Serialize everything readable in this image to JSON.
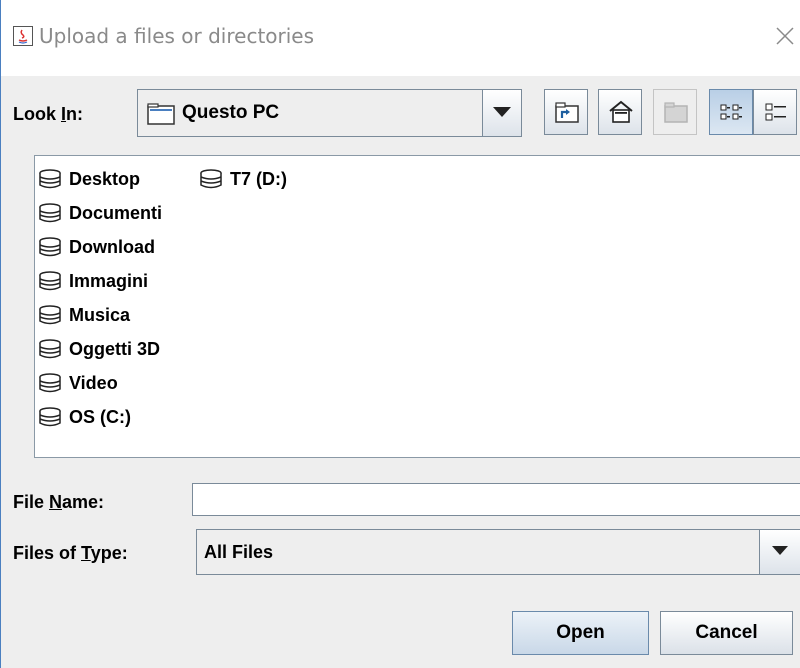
{
  "window": {
    "title": "Upload a files or directories"
  },
  "look_in": {
    "label_pre": "Look ",
    "label_mnemonic": "I",
    "label_post": "n:",
    "value": "Questo PC"
  },
  "toolbar": {
    "up_folder": "up-one-level",
    "home": "home",
    "new_folder": "create-new-folder",
    "list_view": "list",
    "details_view": "details"
  },
  "files": [
    {
      "name": "Desktop",
      "icon": "drive-icon"
    },
    {
      "name": "Documenti",
      "icon": "drive-icon"
    },
    {
      "name": "Download",
      "icon": "drive-icon"
    },
    {
      "name": "Immagini",
      "icon": "drive-icon"
    },
    {
      "name": "Musica",
      "icon": "drive-icon"
    },
    {
      "name": "Oggetti 3D",
      "icon": "drive-icon"
    },
    {
      "name": "Video",
      "icon": "drive-icon"
    },
    {
      "name": "OS (C:)",
      "icon": "drive-icon"
    },
    {
      "name": "T7 (D:)",
      "icon": "drive-icon"
    }
  ],
  "file_name": {
    "label_pre": "File ",
    "label_mnemonic": "N",
    "label_post": "ame:",
    "value": ""
  },
  "file_type": {
    "label_pre": "Files of ",
    "label_mnemonic": "T",
    "label_post": "ype:",
    "value": "All Files"
  },
  "buttons": {
    "open": "Open",
    "cancel": "Cancel"
  }
}
